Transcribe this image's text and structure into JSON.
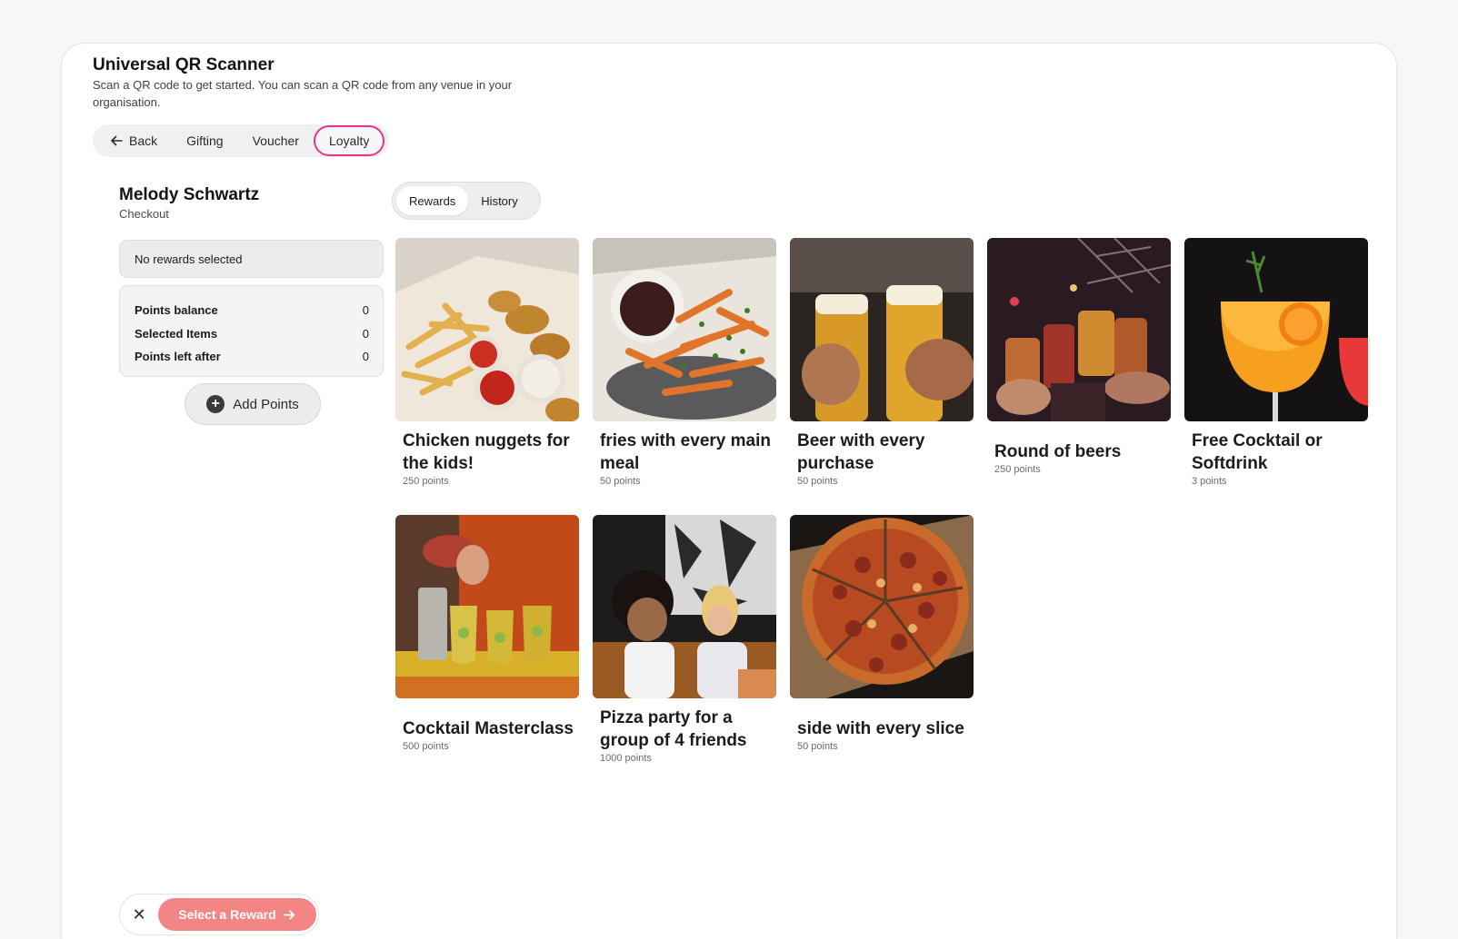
{
  "header": {
    "title": "Universal QR Scanner",
    "subtitle": "Scan a QR code to get started. You can scan a QR code from any venue in your organisation."
  },
  "topnav": {
    "back": "Back",
    "gifting": "Gifting",
    "voucher": "Voucher",
    "loyalty": "Loyalty",
    "active": "Loyalty",
    "accent_color": "#e8328c"
  },
  "customer": {
    "name": "Melody Schwartz",
    "subtitle": "Checkout"
  },
  "selection": {
    "empty_label": "No rewards selected"
  },
  "summary": {
    "points_balance_label": "Points balance",
    "points_balance_value": "0",
    "selected_items_label": "Selected Items",
    "selected_items_value": "0",
    "points_left_label": "Points left after",
    "points_left_value": "0"
  },
  "add_points": {
    "label": "Add Points",
    "icon": "plus-circle-icon"
  },
  "tabs": {
    "rewards": "Rewards",
    "history": "History",
    "active": "Rewards"
  },
  "rewards": [
    {
      "name": "Chicken nuggets for the kids!",
      "points": "250 points",
      "image": "chicken-nuggets-photo"
    },
    {
      "name": "fries with every main meal",
      "points": "50 points",
      "image": "fries-photo"
    },
    {
      "name": "Beer with every purchase",
      "points": "50 points",
      "image": "beer-photo"
    },
    {
      "name": "Round of beers",
      "points": "250 points",
      "image": "round-of-beers-photo"
    },
    {
      "name": "Free Cocktail or Softdrink",
      "points": "3 points",
      "image": "cocktail-photo"
    },
    {
      "name": "Cocktail Masterclass",
      "points": "500 points",
      "image": "masterclass-photo"
    },
    {
      "name": "Pizza party for a group of 4 friends",
      "points": "1000 points",
      "image": "pizza-party-photo"
    },
    {
      "name": "side with every slice",
      "points": "50 points",
      "image": "pizza-photo"
    }
  ],
  "bottom_bar": {
    "close_icon": "close-icon",
    "select_label": "Select a Reward",
    "select_color": "#f38585"
  }
}
